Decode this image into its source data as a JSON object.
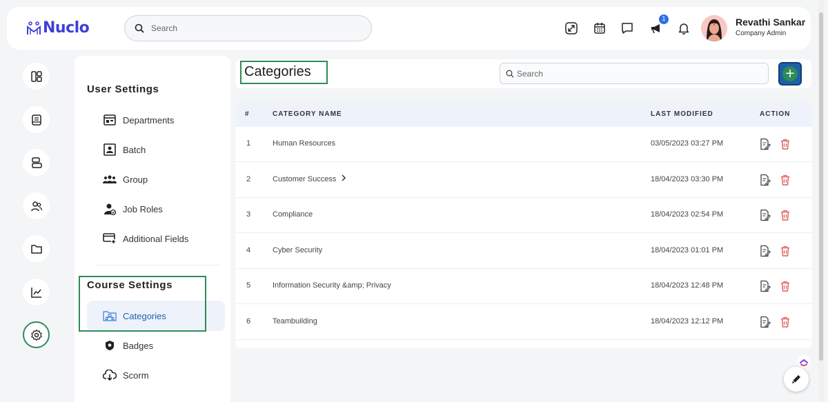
{
  "app": {
    "logo_text": "Nuclo"
  },
  "header": {
    "search_placeholder": "Search",
    "notification_count": "1",
    "user_name": "Revathi Sankar",
    "user_role": "Company Admin"
  },
  "settings": {
    "user_settings_title": "User Settings",
    "user_items": [
      {
        "label": "Departments",
        "icon": "departments-icon"
      },
      {
        "label": "Batch",
        "icon": "batch-icon"
      },
      {
        "label": "Group",
        "icon": "group-icon"
      },
      {
        "label": "Job Roles",
        "icon": "job-roles-icon"
      },
      {
        "label": "Additional Fields",
        "icon": "additional-fields-icon"
      }
    ],
    "course_settings_title": "Course Settings",
    "course_items": [
      {
        "label": "Categories",
        "icon": "categories-icon",
        "active": true
      },
      {
        "label": "Badges",
        "icon": "badge-icon"
      },
      {
        "label": "Scorm",
        "icon": "cloud-download-icon"
      }
    ]
  },
  "main": {
    "title": "Categories",
    "search_placeholder": "Search",
    "table": {
      "headers": [
        "#",
        "CATEGORY NAME",
        "LAST MODIFIED",
        "ACTION"
      ],
      "rows": [
        {
          "num": "1",
          "name": "Human Resources",
          "modified": "03/05/2023 03:27 PM"
        },
        {
          "num": "2",
          "name": "Customer Success",
          "modified": "18/04/2023 03:30 PM",
          "has_children": true
        },
        {
          "num": "3",
          "name": "Compliance",
          "modified": "18/04/2023 02:54 PM"
        },
        {
          "num": "4",
          "name": "Cyber Security",
          "modified": "18/04/2023 01:01 PM"
        },
        {
          "num": "5",
          "name": "Information Security &amp; Privacy",
          "modified": "18/04/2023 12:48 PM"
        },
        {
          "num": "6",
          "name": "Teambuilding",
          "modified": "18/04/2023 12:12 PM"
        }
      ]
    }
  },
  "colors": {
    "accent": "#3d3fd9",
    "highlight": "#2e8b57",
    "delete": "#e05a5a",
    "header_row": "#eef2fb"
  }
}
